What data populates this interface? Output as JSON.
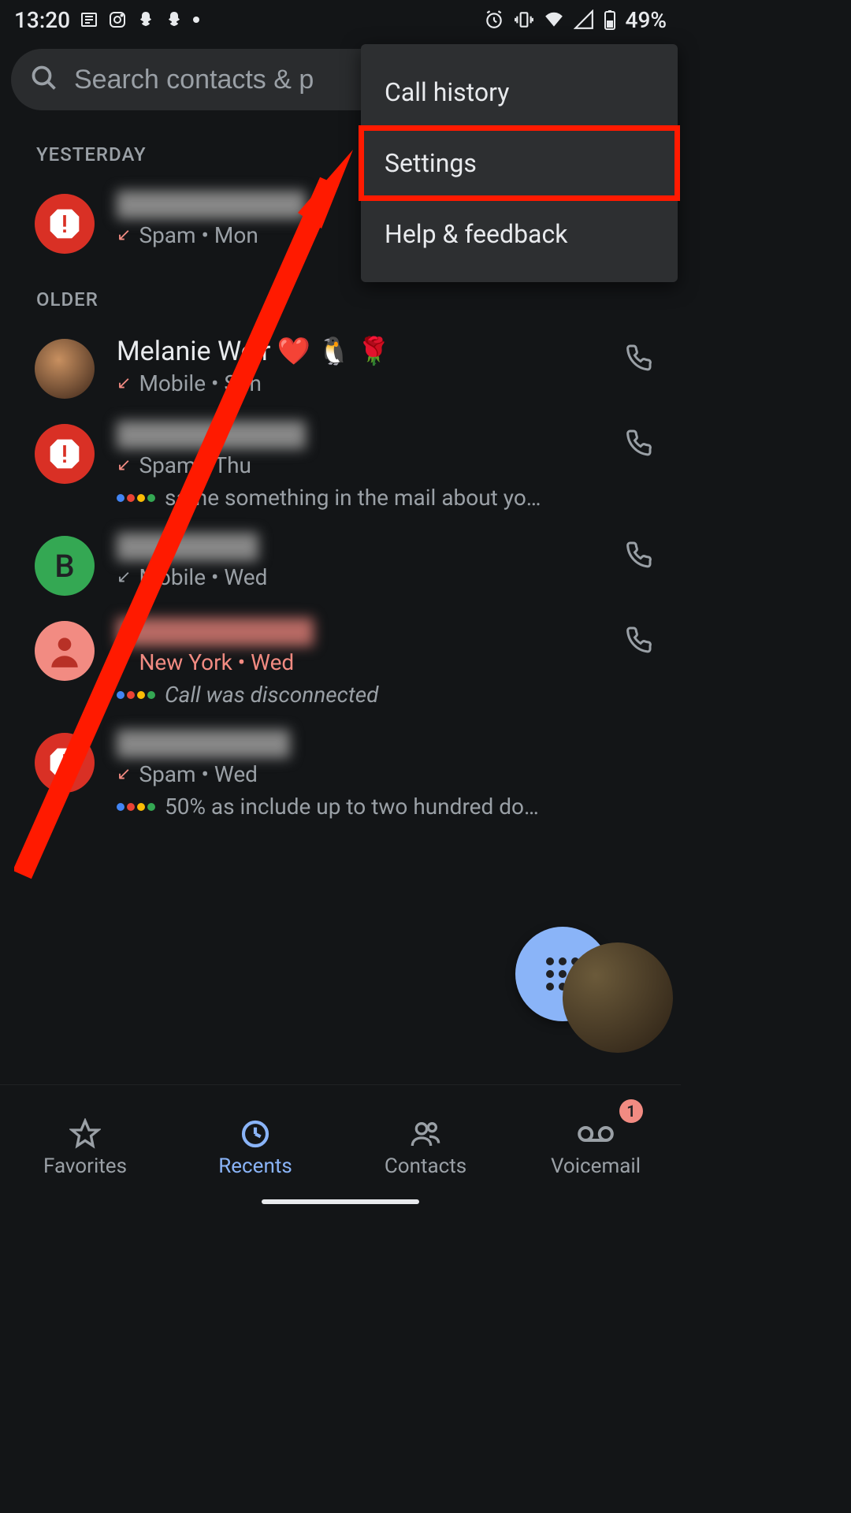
{
  "status": {
    "time": "13:20",
    "battery": "49%"
  },
  "search": {
    "placeholder": "Search contacts & p"
  },
  "menu": {
    "items": [
      "Call history",
      "Settings",
      "Help & feedback"
    ],
    "highlight_index": 1
  },
  "sections": {
    "yesterday": "YESTERDAY",
    "older": "OLDER"
  },
  "calls": [
    {
      "section": "yesterday",
      "avatar_type": "spam",
      "name_redacted": true,
      "sub": "Spam • Mon",
      "missed": true
    },
    {
      "section": "older",
      "avatar_type": "photo",
      "name": "Melanie Weir ❤️ 🐧 🌹",
      "sub": "Mobile • Sun",
      "missed": true
    },
    {
      "section": "older",
      "avatar_type": "spam",
      "name_redacted": true,
      "sub": "Spam • Thu",
      "missed": true,
      "transcript": "same something in the mail about yo…"
    },
    {
      "section": "older",
      "avatar_type": "letter",
      "letter": "B",
      "name_redacted": true,
      "sub": "Mobile • Wed",
      "missed": false,
      "incoming": true
    },
    {
      "section": "older",
      "avatar_type": "person",
      "name_redacted": true,
      "sub": "New York • Wed",
      "missed": true,
      "transcript": "Call was disconnected",
      "transcript_italic": true
    },
    {
      "section": "older",
      "avatar_type": "spam",
      "name_redacted": true,
      "sub": "Spam • Wed",
      "missed": true,
      "transcript": "50% as include up to two hundred do…"
    }
  ],
  "nav": {
    "items": [
      "Favorites",
      "Recents",
      "Contacts",
      "Voicemail"
    ],
    "active_index": 1,
    "voicemail_badge": "1"
  }
}
